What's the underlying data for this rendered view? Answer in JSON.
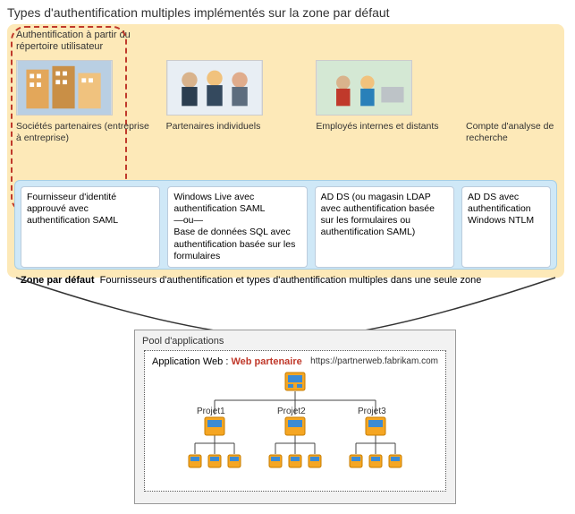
{
  "title": "Types d'authentification multiples implémentés sur la zone par défaut",
  "userDirLabel": "Authentification à partir du répertoire utilisateur",
  "columns": [
    {
      "label": "Sociétés partenaires (entreprise à entreprise)",
      "box": "Fournisseur d'identité approuvé avec authentification SAML"
    },
    {
      "label": "Partenaires individuels",
      "box": "Windows Live avec authentification SAML\n—ou—\nBase de données SQL avec authentification basée sur les formulaires"
    },
    {
      "label": "Employés internes et distants",
      "box": "AD DS (ou magasin LDAP avec authentification basée sur les formulaires ou authentification SAML)"
    },
    {
      "label": "Compte d'analyse de recherche",
      "box": "AD DS avec authentification Windows NTLM"
    }
  ],
  "zoneFooter": {
    "bold": "Zone par défaut",
    "rest": "Fournisseurs d'authentification et types d'authentification multiples dans une seule zone"
  },
  "pool": {
    "title": "Pool d'applications",
    "appLabel": "Application Web :",
    "appName": "Web partenaire",
    "url": "https://partnerweb.fabrikam.com",
    "projects": [
      "Projet1",
      "Projet2",
      "Projet3"
    ]
  }
}
